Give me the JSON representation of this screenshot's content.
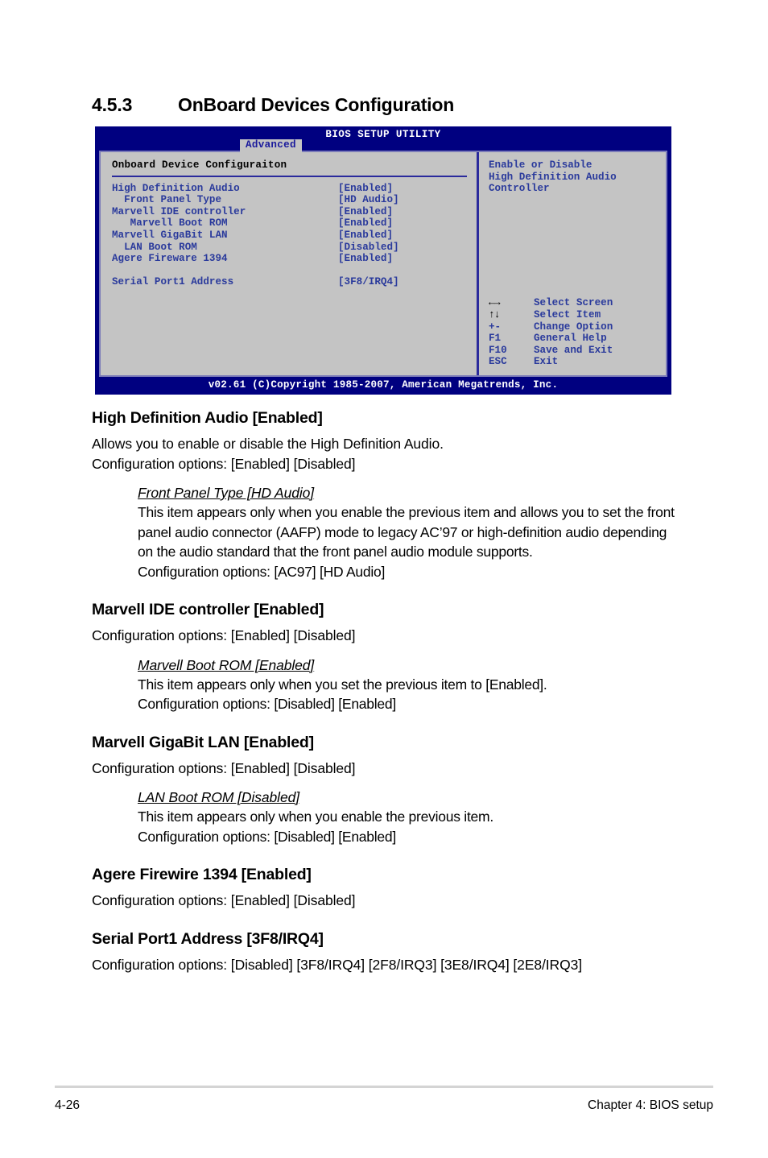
{
  "section": {
    "number": "4.5.3",
    "title": "OnBoard Devices Configuration"
  },
  "bios": {
    "utility_title": "BIOS SETUP UTILITY",
    "active_tab": "Advanced",
    "panel_title": "Onboard Device Configuraiton",
    "items": [
      {
        "label": "High Definition Audio",
        "value": "[Enabled]"
      },
      {
        "label": "  Front Panel Type",
        "value": "[HD Audio]"
      },
      {
        "label": "Marvell IDE controller",
        "value": "[Enabled]"
      },
      {
        "label": "   Marvell Boot ROM",
        "value": "[Enabled]"
      },
      {
        "label": "Marvell GigaBit LAN",
        "value": "[Enabled]"
      },
      {
        "label": "  LAN Boot ROM",
        "value": "[Disabled]"
      },
      {
        "label": "Agere Fireware 1394",
        "value": "[Enabled]"
      },
      {
        "label": "",
        "value": ""
      },
      {
        "label": "Serial Port1 Address",
        "value": "[3F8/IRQ4]"
      }
    ],
    "help": "Enable or Disable\nHigh Definition Audio\nController",
    "keys": [
      {
        "key": "←→",
        "desc": "Select Screen",
        "glyph": true
      },
      {
        "key": "↑↓",
        "desc": "Select Item",
        "glyph": true
      },
      {
        "key": "+-",
        "desc": "Change Option",
        "glyph": false
      },
      {
        "key": "F1",
        "desc": "General Help",
        "glyph": false
      },
      {
        "key": "F10",
        "desc": "Save and Exit",
        "glyph": false
      },
      {
        "key": "ESC",
        "desc": "Exit",
        "glyph": false
      }
    ],
    "copyright": "v02.61 (C)Copyright 1985-2007, American Megatrends, Inc."
  },
  "sections": [
    {
      "heading": "High Definition Audio [Enabled]",
      "body": "Allows you to enable or disable the High Definition Audio.\nConfiguration options: [Enabled] [Disabled]",
      "sub": [
        {
          "heading": "Front Panel Type [HD Audio]",
          "body": "This item appears only when you enable the previous item and allows you to set the front panel audio connector (AAFP) mode to legacy AC’97 or high-definition audio depending on the audio standard that the front panel audio module supports.\nConfiguration options: [AC97] [HD Audio]"
        }
      ]
    },
    {
      "heading": "Marvell IDE controller [Enabled]",
      "body": "Configuration options: [Enabled] [Disabled]",
      "sub": [
        {
          "heading": "Marvell Boot ROM [Enabled]",
          "body": "This item appears only when you set the previous item to [Enabled].\nConfiguration options: [Disabled] [Enabled]"
        }
      ]
    },
    {
      "heading": "Marvell GigaBit LAN [Enabled]",
      "body": "Configuration options: [Enabled] [Disabled]",
      "sub": [
        {
          "heading": "LAN Boot ROM [Disabled]",
          "body": "This item appears only when you enable the previous item.\nConfiguration options: [Disabled] [Enabled]"
        }
      ]
    },
    {
      "heading": "Agere Firewire 1394 [Enabled]",
      "body": "Configuration options: [Enabled] [Disabled]",
      "sub": []
    },
    {
      "heading": "Serial Port1 Address [3F8/IRQ4]",
      "body": "Configuration options: [Disabled] [3F8/IRQ4] [2F8/IRQ3] [3E8/IRQ4] [2E8/IRQ3]",
      "sub": []
    }
  ],
  "footer": {
    "page_number": "4-26",
    "chapter": "Chapter 4: BIOS setup"
  }
}
